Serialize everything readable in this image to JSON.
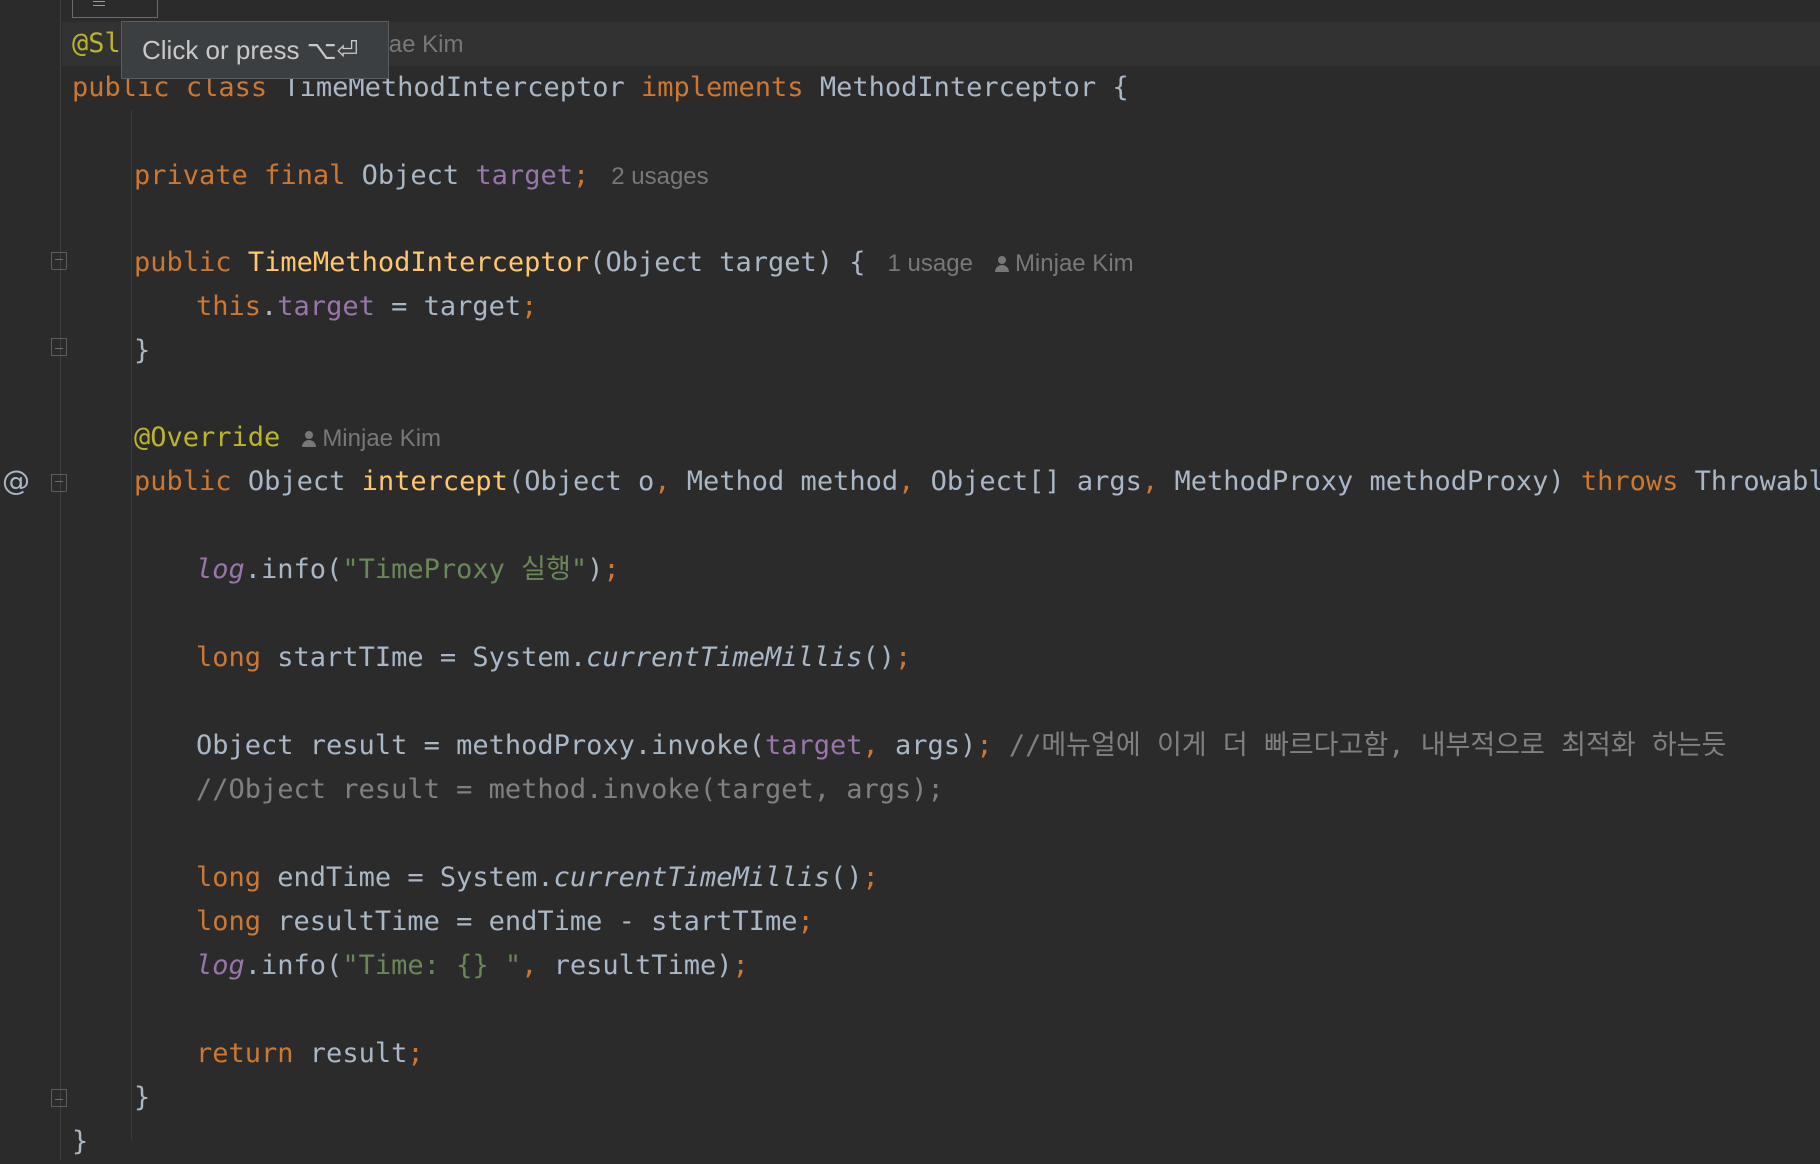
{
  "tooltip": {
    "text": "Click or press ⌥⏎"
  },
  "code": {
    "l1_ann": "@Sl",
    "l1_author": "ae Kim",
    "l2": {
      "kw1": "public",
      "kw2": "class",
      "name": "TimeMethodInterceptor",
      "kw3": "implements",
      "iface": "MethodInterceptor",
      "brace": "{"
    },
    "l4": {
      "kw1": "private",
      "kw2": "final",
      "type": "Object",
      "field": "target",
      "semi": ";",
      "hint": "2 usages"
    },
    "l6": {
      "kw": "public",
      "ctor": "TimeMethodInterceptor",
      "params": "(Object target) {",
      "hint": "1 usage",
      "author": "Minjae Kim"
    },
    "l7": {
      "this": "this",
      "dot": ".",
      "field": "target",
      "rest": " = target",
      "semi": ";"
    },
    "l8": "}",
    "l10": {
      "ann": "@Override",
      "author": "Minjae Kim"
    },
    "l11": {
      "kw": "public",
      "type": "Object",
      "name": "intercept",
      "p1": "(Object o",
      "c1": ",",
      "p2": " Method method",
      "c2": ",",
      "p3": " Object[] args",
      "c3": ",",
      "p4": " MethodProxy methodProxy) ",
      "throws": "throws",
      "exc": " Throwable {"
    },
    "l13": {
      "log": "log",
      "call": ".info(",
      "str": "\"TimeProxy 실행\"",
      "close": ")",
      "semi": ";"
    },
    "l15": {
      "kw": "long",
      "rest": " startTIme = System.",
      "method": "currentTimeMillis",
      "call": "()",
      "semi": ";"
    },
    "l17": {
      "pre": "Object result = methodProxy.invoke(",
      "field": "target",
      "comma": ",",
      "args": " args)",
      "semi": ";",
      "comment": " //메뉴얼에 이게 더 빠르다고함, 내부적으로 최적화 하는듯"
    },
    "l18": "//Object result = method.invoke(target, args);",
    "l20": {
      "kw": "long",
      "rest": " endTime = System.",
      "method": "currentTimeMillis",
      "call": "()",
      "semi": ";"
    },
    "l21": {
      "kw": "long",
      "rest": " resultTime = endTime - startTIme",
      "semi": ";"
    },
    "l22": {
      "log": "log",
      "call": ".info(",
      "str": "\"Time: {} \"",
      "comma": ",",
      "rest": " resultTime)",
      "semi": ";"
    },
    "l24": {
      "kw": "return",
      "rest": " result",
      "semi": ";"
    },
    "l25": "}",
    "l26": "}"
  },
  "gutter": {
    "override_marker": "@"
  }
}
